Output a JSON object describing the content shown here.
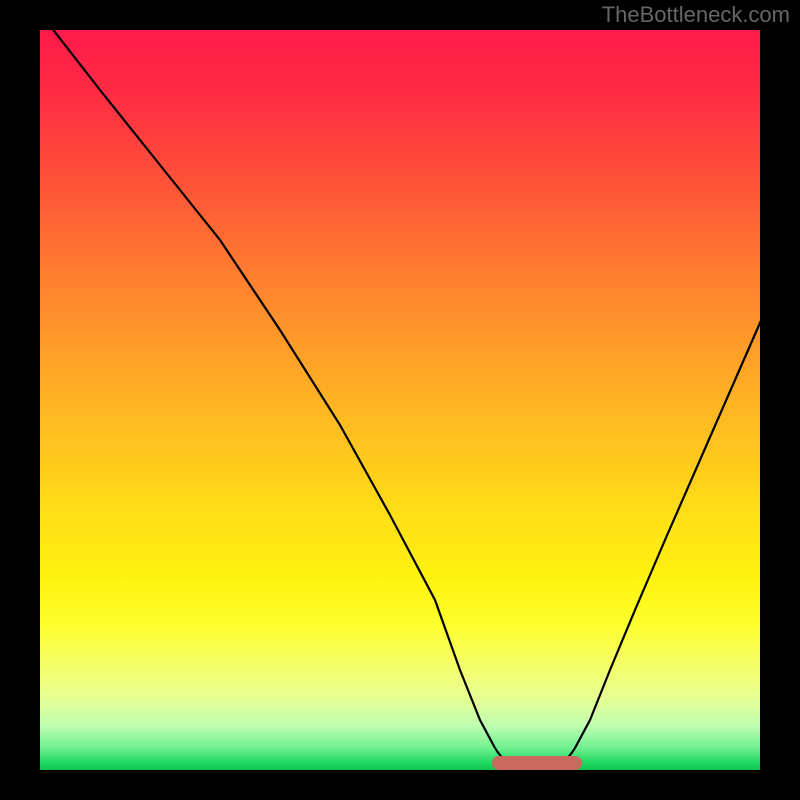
{
  "watermark": "TheBottleneck.com",
  "chart_data": {
    "type": "line",
    "title": "",
    "xlabel": "",
    "ylabel": "",
    "xlim": [
      0,
      100
    ],
    "ylim": [
      0,
      100
    ],
    "gradient_colors": {
      "top_red": "#ff1a4a",
      "mid_orange": "#ff7a30",
      "mid_yellow": "#fff20f",
      "bottom_green": "#10c850"
    },
    "curve_description": "V-shaped curve descending from top-left to a flat minimum near x≈65 then rising to the right edge",
    "x": [
      0,
      5,
      10,
      15,
      20,
      25,
      30,
      35,
      40,
      45,
      50,
      55,
      58,
      60,
      63,
      67,
      70,
      72,
      75,
      80,
      85,
      90,
      95,
      100
    ],
    "y": [
      102,
      95,
      87,
      79,
      71,
      63,
      55,
      47,
      39,
      31,
      22,
      12,
      5,
      2,
      0.5,
      0.5,
      2,
      5,
      10,
      20,
      32,
      45,
      57,
      68
    ],
    "minimum_band": {
      "x_start": 58,
      "x_end": 72,
      "y": 0.5
    },
    "marker_color": "#c9695f"
  }
}
